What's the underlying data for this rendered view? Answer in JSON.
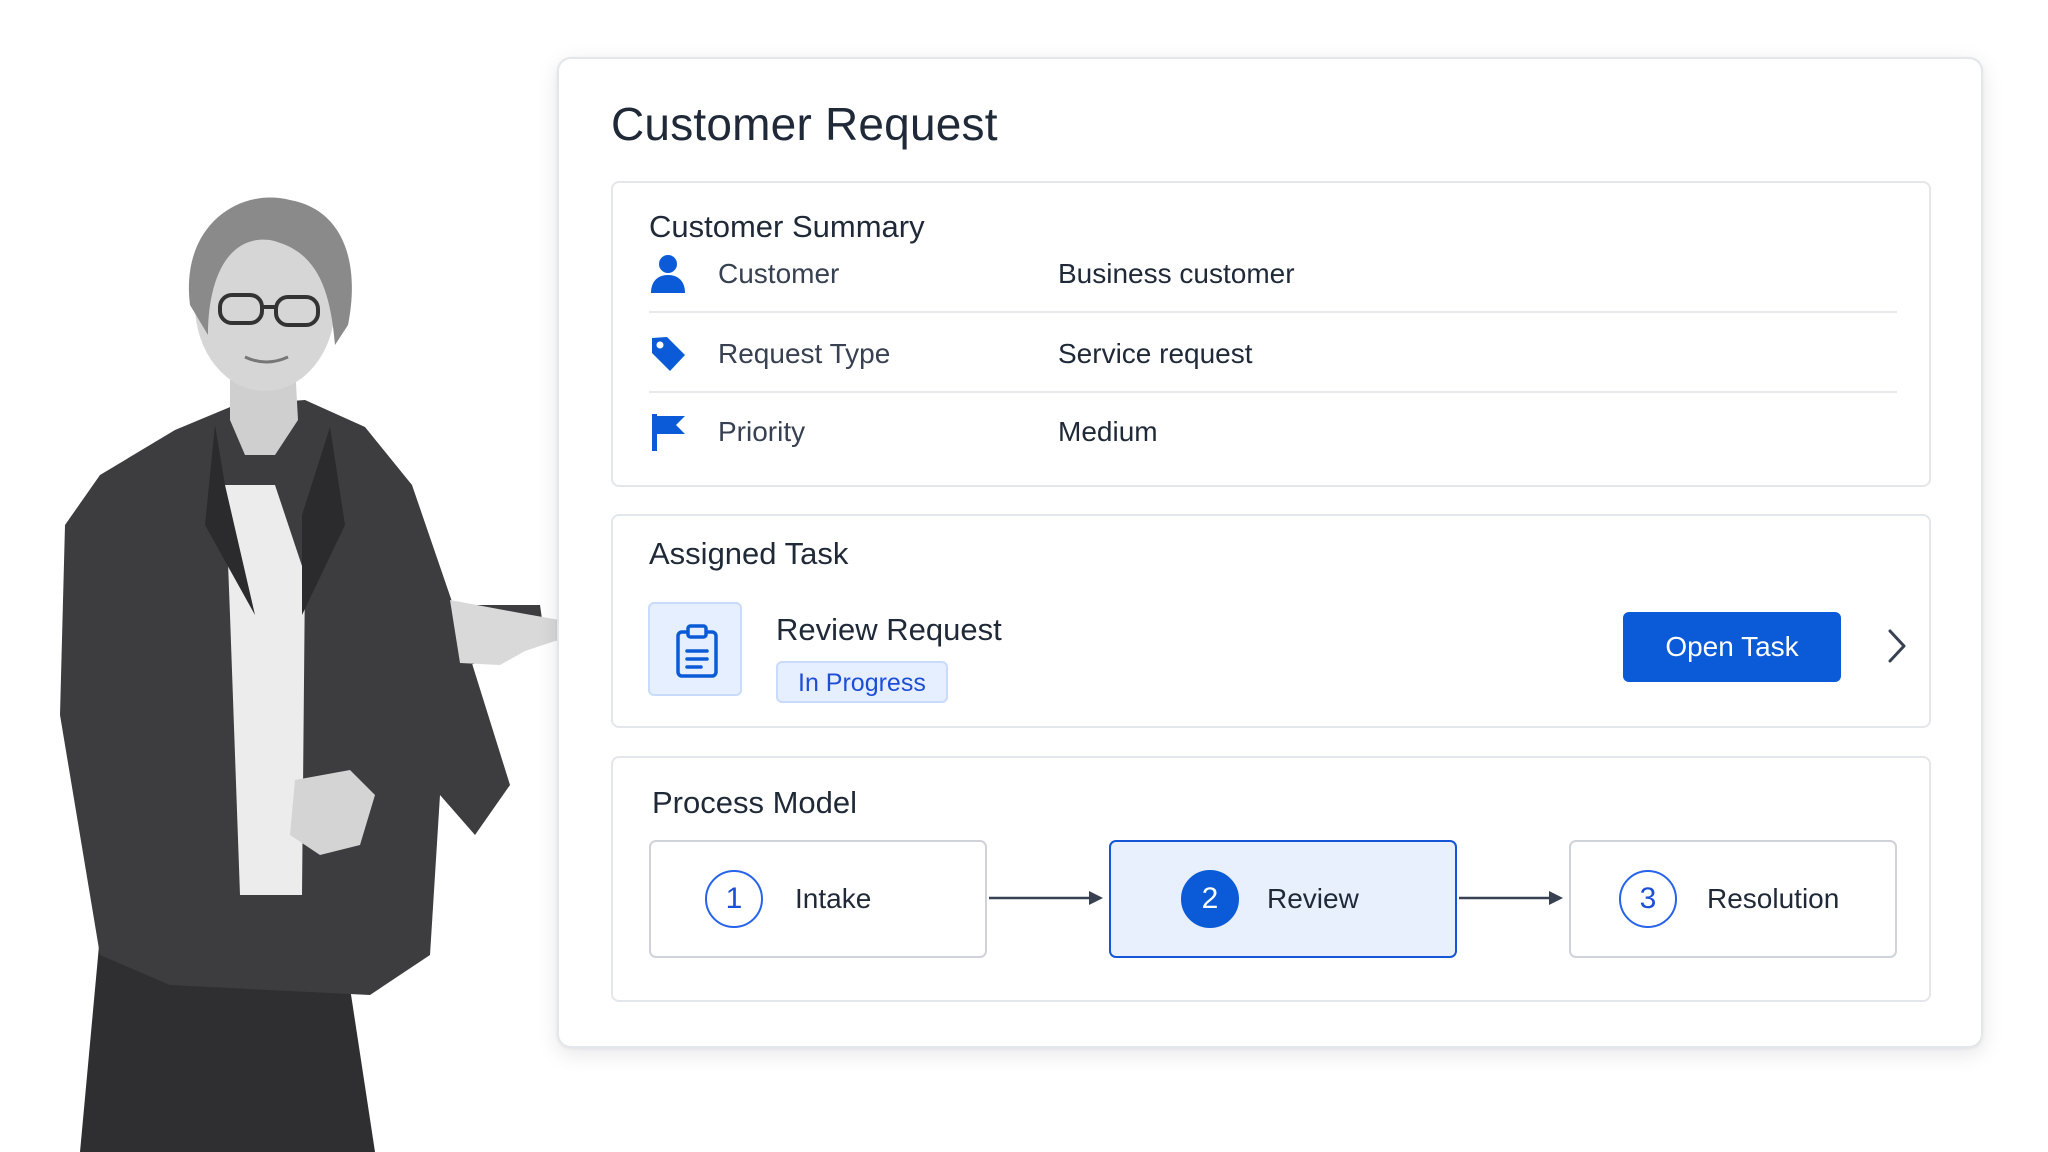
{
  "page": {
    "title": "Customer Request"
  },
  "summary": {
    "title": "Customer Summary",
    "rows": [
      {
        "icon": "person-icon",
        "label": "Customer",
        "value": "Business customer"
      },
      {
        "icon": "tag-icon",
        "label": "Request Type",
        "value": "Service request"
      },
      {
        "icon": "flag-icon",
        "label": "Priority",
        "value": "Medium"
      }
    ]
  },
  "task": {
    "title": "Assigned Task",
    "icon": "clipboard-icon",
    "name": "Review Request",
    "status": "In Progress",
    "open_label": "Open Task",
    "chevron_icon": "chevron-right-icon"
  },
  "process": {
    "title": "Process Model",
    "steps": [
      {
        "number": "1",
        "label": "Intake",
        "active": false
      },
      {
        "number": "2",
        "label": "Review",
        "active": true
      },
      {
        "number": "3",
        "label": "Resolution",
        "active": false
      }
    ]
  },
  "colors": {
    "accent": "#0b5bd8",
    "accent_light": "#e6efff",
    "border": "#e3e6ea",
    "text": "#1f2937"
  }
}
